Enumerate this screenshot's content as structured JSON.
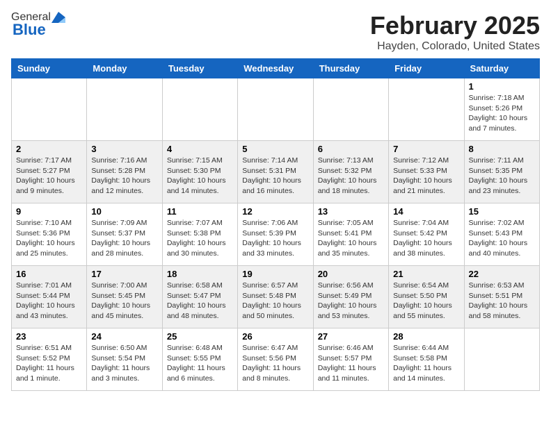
{
  "header": {
    "logo_general": "General",
    "logo_blue": "Blue",
    "title": "February 2025",
    "subtitle": "Hayden, Colorado, United States"
  },
  "calendar": {
    "days_of_week": [
      "Sunday",
      "Monday",
      "Tuesday",
      "Wednesday",
      "Thursday",
      "Friday",
      "Saturday"
    ],
    "weeks": [
      [
        {
          "day": "",
          "info": ""
        },
        {
          "day": "",
          "info": ""
        },
        {
          "day": "",
          "info": ""
        },
        {
          "day": "",
          "info": ""
        },
        {
          "day": "",
          "info": ""
        },
        {
          "day": "",
          "info": ""
        },
        {
          "day": "1",
          "info": "Sunrise: 7:18 AM\nSunset: 5:26 PM\nDaylight: 10 hours and 7 minutes."
        }
      ],
      [
        {
          "day": "2",
          "info": "Sunrise: 7:17 AM\nSunset: 5:27 PM\nDaylight: 10 hours and 9 minutes."
        },
        {
          "day": "3",
          "info": "Sunrise: 7:16 AM\nSunset: 5:28 PM\nDaylight: 10 hours and 12 minutes."
        },
        {
          "day": "4",
          "info": "Sunrise: 7:15 AM\nSunset: 5:30 PM\nDaylight: 10 hours and 14 minutes."
        },
        {
          "day": "5",
          "info": "Sunrise: 7:14 AM\nSunset: 5:31 PM\nDaylight: 10 hours and 16 minutes."
        },
        {
          "day": "6",
          "info": "Sunrise: 7:13 AM\nSunset: 5:32 PM\nDaylight: 10 hours and 18 minutes."
        },
        {
          "day": "7",
          "info": "Sunrise: 7:12 AM\nSunset: 5:33 PM\nDaylight: 10 hours and 21 minutes."
        },
        {
          "day": "8",
          "info": "Sunrise: 7:11 AM\nSunset: 5:35 PM\nDaylight: 10 hours and 23 minutes."
        }
      ],
      [
        {
          "day": "9",
          "info": "Sunrise: 7:10 AM\nSunset: 5:36 PM\nDaylight: 10 hours and 25 minutes."
        },
        {
          "day": "10",
          "info": "Sunrise: 7:09 AM\nSunset: 5:37 PM\nDaylight: 10 hours and 28 minutes."
        },
        {
          "day": "11",
          "info": "Sunrise: 7:07 AM\nSunset: 5:38 PM\nDaylight: 10 hours and 30 minutes."
        },
        {
          "day": "12",
          "info": "Sunrise: 7:06 AM\nSunset: 5:39 PM\nDaylight: 10 hours and 33 minutes."
        },
        {
          "day": "13",
          "info": "Sunrise: 7:05 AM\nSunset: 5:41 PM\nDaylight: 10 hours and 35 minutes."
        },
        {
          "day": "14",
          "info": "Sunrise: 7:04 AM\nSunset: 5:42 PM\nDaylight: 10 hours and 38 minutes."
        },
        {
          "day": "15",
          "info": "Sunrise: 7:02 AM\nSunset: 5:43 PM\nDaylight: 10 hours and 40 minutes."
        }
      ],
      [
        {
          "day": "16",
          "info": "Sunrise: 7:01 AM\nSunset: 5:44 PM\nDaylight: 10 hours and 43 minutes."
        },
        {
          "day": "17",
          "info": "Sunrise: 7:00 AM\nSunset: 5:45 PM\nDaylight: 10 hours and 45 minutes."
        },
        {
          "day": "18",
          "info": "Sunrise: 6:58 AM\nSunset: 5:47 PM\nDaylight: 10 hours and 48 minutes."
        },
        {
          "day": "19",
          "info": "Sunrise: 6:57 AM\nSunset: 5:48 PM\nDaylight: 10 hours and 50 minutes."
        },
        {
          "day": "20",
          "info": "Sunrise: 6:56 AM\nSunset: 5:49 PM\nDaylight: 10 hours and 53 minutes."
        },
        {
          "day": "21",
          "info": "Sunrise: 6:54 AM\nSunset: 5:50 PM\nDaylight: 10 hours and 55 minutes."
        },
        {
          "day": "22",
          "info": "Sunrise: 6:53 AM\nSunset: 5:51 PM\nDaylight: 10 hours and 58 minutes."
        }
      ],
      [
        {
          "day": "23",
          "info": "Sunrise: 6:51 AM\nSunset: 5:52 PM\nDaylight: 11 hours and 1 minute."
        },
        {
          "day": "24",
          "info": "Sunrise: 6:50 AM\nSunset: 5:54 PM\nDaylight: 11 hours and 3 minutes."
        },
        {
          "day": "25",
          "info": "Sunrise: 6:48 AM\nSunset: 5:55 PM\nDaylight: 11 hours and 6 minutes."
        },
        {
          "day": "26",
          "info": "Sunrise: 6:47 AM\nSunset: 5:56 PM\nDaylight: 11 hours and 8 minutes."
        },
        {
          "day": "27",
          "info": "Sunrise: 6:46 AM\nSunset: 5:57 PM\nDaylight: 11 hours and 11 minutes."
        },
        {
          "day": "28",
          "info": "Sunrise: 6:44 AM\nSunset: 5:58 PM\nDaylight: 11 hours and 14 minutes."
        },
        {
          "day": "",
          "info": ""
        }
      ]
    ]
  }
}
